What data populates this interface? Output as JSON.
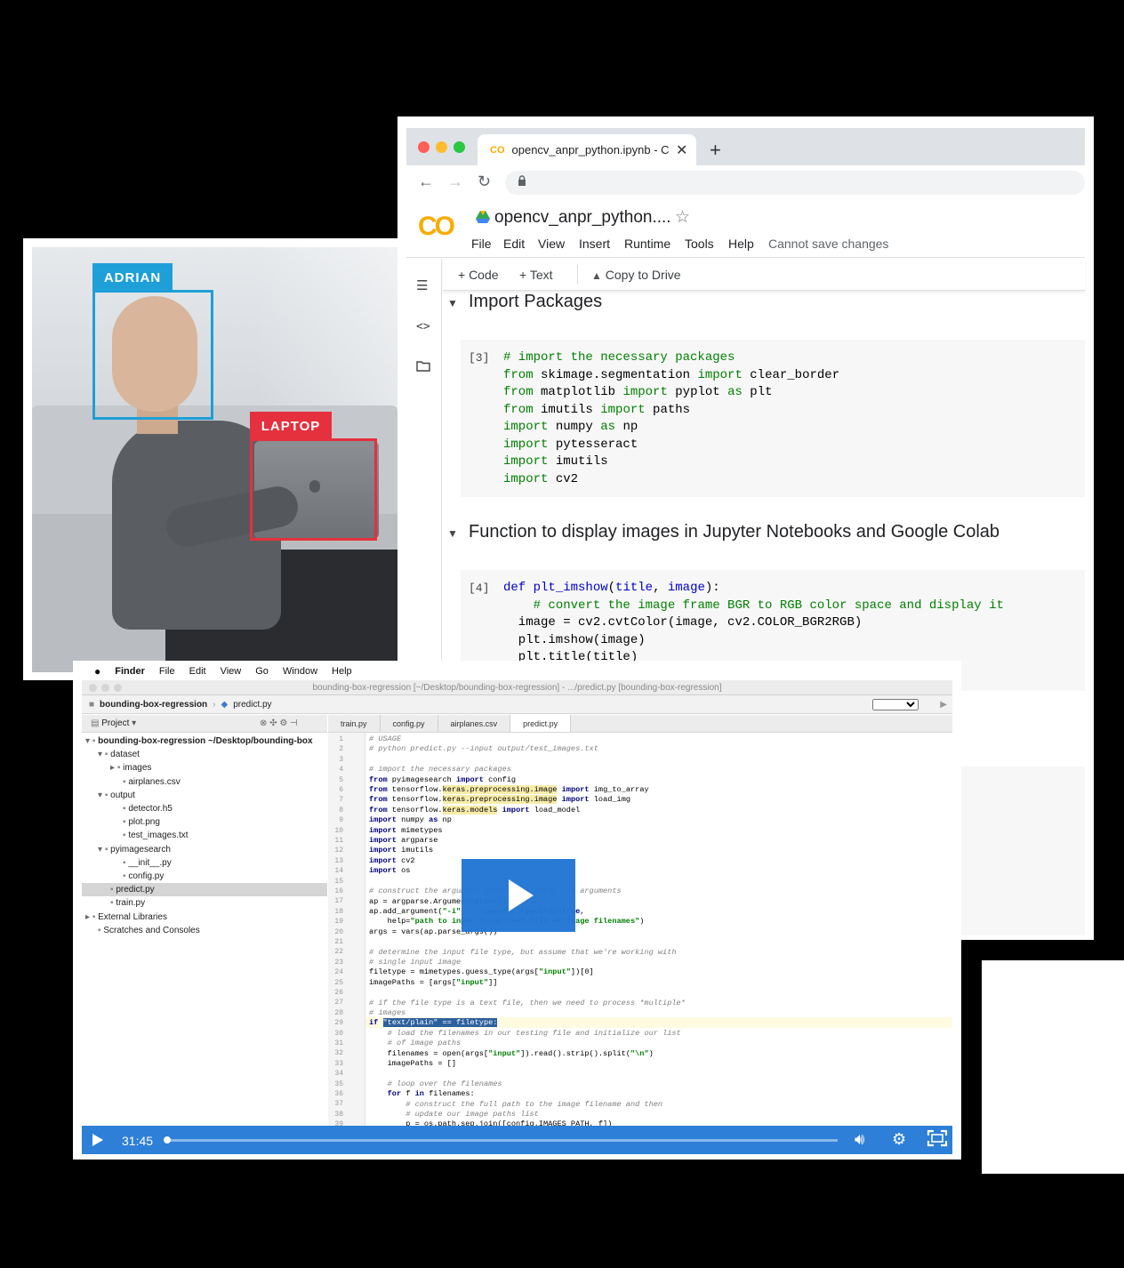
{
  "photo": {
    "label_person": "ADRIAN",
    "label_laptop": "LAPTOP",
    "colors": {
      "person_box": "#1e9fd8",
      "laptop_box": "#e5303d"
    }
  },
  "browser": {
    "tab_title": "opencv_anpr_python.ipynb - C",
    "tab_favicon": "CO",
    "new_tab": "+",
    "close_tab": "✕",
    "colab_logo": "CO",
    "notebook_title": "opencv_anpr_python....",
    "menu": [
      "File",
      "Edit",
      "View",
      "Insert",
      "Runtime",
      "Tools",
      "Help"
    ],
    "status": "Cannot save changes",
    "toolbar": {
      "code": "+ Code",
      "text": "+ Text",
      "copy": "Copy to Drive"
    },
    "sections": [
      {
        "title": "Import Packages"
      },
      {
        "title": "Function to display images in Jupyter Notebooks and Google Colab"
      }
    ],
    "cells": [
      {
        "exec": "[3]"
      },
      {
        "exec": "[4]"
      }
    ]
  },
  "video": {
    "mac_menu": [
      "Finder",
      "File",
      "Edit",
      "View",
      "Go",
      "Window",
      "Help"
    ],
    "ide_title": "bounding-box-regression [~/Desktop/bounding-box-regression] - .../predict.py [bounding-box-regression]",
    "breadcrumb": [
      "bounding-box-regression",
      "predict.py"
    ],
    "project_label": "Project",
    "tree": [
      {
        "name": "bounding-box-regression ~/Desktop/bounding-box",
        "indent": 0,
        "icon": "▾"
      },
      {
        "name": "dataset",
        "indent": 1,
        "icon": "▾"
      },
      {
        "name": "images",
        "indent": 2,
        "icon": "▸"
      },
      {
        "name": "airplanes.csv",
        "indent": 3,
        "icon": ""
      },
      {
        "name": "output",
        "indent": 1,
        "icon": "▾"
      },
      {
        "name": "detector.h5",
        "indent": 3,
        "icon": ""
      },
      {
        "name": "plot.png",
        "indent": 3,
        "icon": ""
      },
      {
        "name": "test_images.txt",
        "indent": 3,
        "icon": ""
      },
      {
        "name": "pyimagesearch",
        "indent": 1,
        "icon": "▾"
      },
      {
        "name": "__init__.py",
        "indent": 3,
        "icon": ""
      },
      {
        "name": "config.py",
        "indent": 3,
        "icon": ""
      },
      {
        "name": "predict.py",
        "indent": 2,
        "icon": "",
        "selected": true
      },
      {
        "name": "train.py",
        "indent": 2,
        "icon": ""
      },
      {
        "name": "External Libraries",
        "indent": 0,
        "icon": "▸"
      },
      {
        "name": "Scratches and Consoles",
        "indent": 1,
        "icon": ""
      }
    ],
    "tabs": [
      {
        "name": "train.py"
      },
      {
        "name": "config.py"
      },
      {
        "name": "airplanes.csv"
      },
      {
        "name": "predict.py",
        "active": true
      }
    ],
    "time": "31:45",
    "progress": 0.002
  }
}
